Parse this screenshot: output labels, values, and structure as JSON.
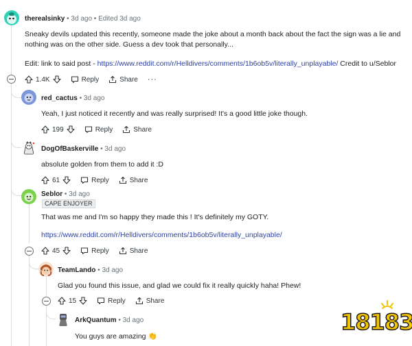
{
  "comments": [
    {
      "username": "therealsinky",
      "meta": "• 3d ago • Edited 3d ago",
      "body": "Sneaky devils updated this recently, someone made the joke about a month back about the fact the sign was a lie and nothing was on the other side. Guess a dev took that personally...",
      "edit_prefix": "Edit: link to said post - ",
      "edit_link": "https://www.reddit.com/r/Helldivers/comments/1b6ob5v/literally_unplayable/",
      "edit_suffix": " Credit to u/Seblor",
      "score": "1.4K",
      "reply_label": "Reply",
      "share_label": "Share",
      "more_label": "···"
    },
    {
      "username": "red_cactus",
      "meta": "• 3d ago",
      "body": "Yeah, I just noticed it recently and was really surprised! It's a good little joke though.",
      "score": "199",
      "reply_label": "Reply",
      "share_label": "Share"
    },
    {
      "username": "DogOfBaskerville",
      "meta": "• 3d ago",
      "body": "absolute golden from them to add it :D",
      "score": "61",
      "reply_label": "Reply",
      "share_label": "Share"
    },
    {
      "username": "Seblor",
      "meta": "• 3d ago",
      "flair": "CAPE ENJOYER",
      "body": "That was me and I'm so happy they made this ! It's definitely my GOTY.",
      "link": "https://www.reddit.com/r/Helldivers/comments/1b6ob5v/literally_unplayable/",
      "score": "45",
      "reply_label": "Reply",
      "share_label": "Share"
    },
    {
      "username": "TeamLando",
      "meta": "• 3d ago",
      "body": "Glad you found this issue, and glad we could fix it really quickly haha! Phew!",
      "score": "15",
      "reply_label": "Reply",
      "share_label": "Share"
    },
    {
      "username": "ArkQuantum",
      "meta": "• 3d ago",
      "body": "You guys are amazing",
      "emoji": "👏"
    }
  ],
  "watermark": {
    "text": "18183"
  },
  "colors": {
    "link": "#2b3fa5",
    "thread_line": "#d8dde0",
    "watermark": "#f2c300"
  }
}
